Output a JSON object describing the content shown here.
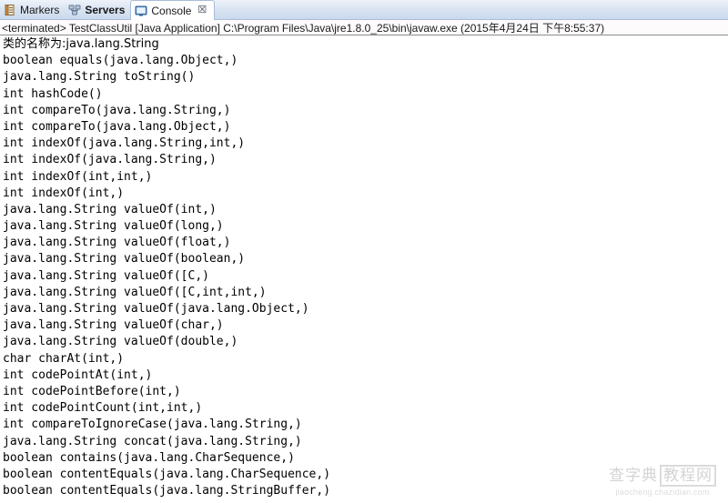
{
  "tabs": [
    {
      "label": "Markers",
      "icon": "markers-icon",
      "active": false,
      "bold": false
    },
    {
      "label": "Servers",
      "icon": "servers-icon",
      "active": false,
      "bold": true
    },
    {
      "label": "Console",
      "icon": "console-icon",
      "active": true,
      "bold": false
    }
  ],
  "tab_close_glyph": "☒",
  "process": {
    "line": "<terminated> TestClassUtil [Java Application] C:\\Program Files\\Java\\jre1.8.0_25\\bin\\javaw.exe (2015年4月24日 下午8:55:37)"
  },
  "console": {
    "lines": [
      "类的名称为:java.lang.String",
      "boolean equals(java.lang.Object,)",
      "java.lang.String toString()",
      "int hashCode()",
      "int compareTo(java.lang.String,)",
      "int compareTo(java.lang.Object,)",
      "int indexOf(java.lang.String,int,)",
      "int indexOf(java.lang.String,)",
      "int indexOf(int,int,)",
      "int indexOf(int,)",
      "java.lang.String valueOf(int,)",
      "java.lang.String valueOf(long,)",
      "java.lang.String valueOf(float,)",
      "java.lang.String valueOf(boolean,)",
      "java.lang.String valueOf([C,)",
      "java.lang.String valueOf([C,int,int,)",
      "java.lang.String valueOf(java.lang.Object,)",
      "java.lang.String valueOf(char,)",
      "java.lang.String valueOf(double,)",
      "char charAt(int,)",
      "int codePointAt(int,)",
      "int codePointBefore(int,)",
      "int codePointCount(int,int,)",
      "int compareToIgnoreCase(java.lang.String,)",
      "java.lang.String concat(java.lang.String,)",
      "boolean contains(java.lang.CharSequence,)",
      "boolean contentEquals(java.lang.CharSequence,)",
      "boolean contentEquals(java.lang.StringBuffer,)"
    ]
  },
  "watermark": {
    "cn_left": "查字典",
    "cn_right": "教程网",
    "url": "jiaocheng.chazidian.com"
  },
  "colors": {
    "tabbar_bg": "#c9d9ed",
    "tab_active_bg": "#ffffff",
    "console_bg": "#ffffff",
    "text": "#000000",
    "border": "#8c8c8c"
  }
}
